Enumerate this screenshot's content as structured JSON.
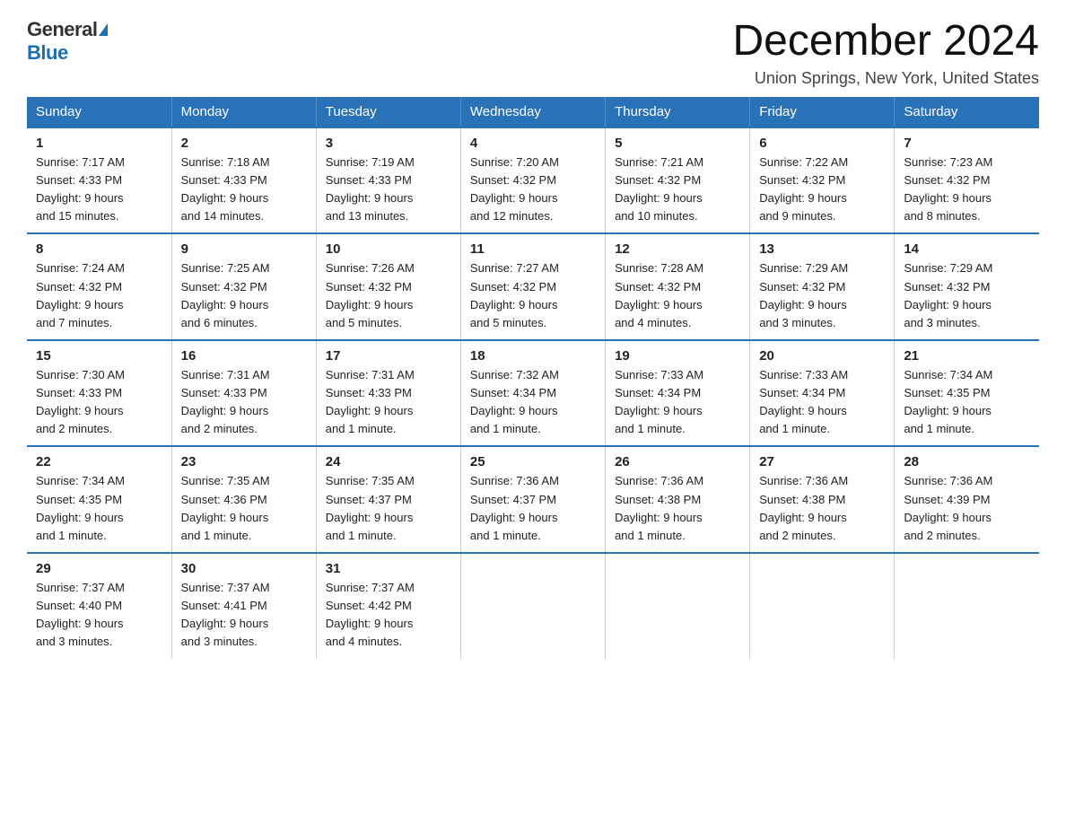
{
  "header": {
    "logo_general": "General",
    "logo_blue": "Blue",
    "month_title": "December 2024",
    "location": "Union Springs, New York, United States"
  },
  "weekdays": [
    "Sunday",
    "Monday",
    "Tuesday",
    "Wednesday",
    "Thursday",
    "Friday",
    "Saturday"
  ],
  "weeks": [
    [
      {
        "day": "1",
        "sunrise": "7:17 AM",
        "sunset": "4:33 PM",
        "daylight": "9 hours and 15 minutes."
      },
      {
        "day": "2",
        "sunrise": "7:18 AM",
        "sunset": "4:33 PM",
        "daylight": "9 hours and 14 minutes."
      },
      {
        "day": "3",
        "sunrise": "7:19 AM",
        "sunset": "4:33 PM",
        "daylight": "9 hours and 13 minutes."
      },
      {
        "day": "4",
        "sunrise": "7:20 AM",
        "sunset": "4:32 PM",
        "daylight": "9 hours and 12 minutes."
      },
      {
        "day": "5",
        "sunrise": "7:21 AM",
        "sunset": "4:32 PM",
        "daylight": "9 hours and 10 minutes."
      },
      {
        "day": "6",
        "sunrise": "7:22 AM",
        "sunset": "4:32 PM",
        "daylight": "9 hours and 9 minutes."
      },
      {
        "day": "7",
        "sunrise": "7:23 AM",
        "sunset": "4:32 PM",
        "daylight": "9 hours and 8 minutes."
      }
    ],
    [
      {
        "day": "8",
        "sunrise": "7:24 AM",
        "sunset": "4:32 PM",
        "daylight": "9 hours and 7 minutes."
      },
      {
        "day": "9",
        "sunrise": "7:25 AM",
        "sunset": "4:32 PM",
        "daylight": "9 hours and 6 minutes."
      },
      {
        "day": "10",
        "sunrise": "7:26 AM",
        "sunset": "4:32 PM",
        "daylight": "9 hours and 5 minutes."
      },
      {
        "day": "11",
        "sunrise": "7:27 AM",
        "sunset": "4:32 PM",
        "daylight": "9 hours and 5 minutes."
      },
      {
        "day": "12",
        "sunrise": "7:28 AM",
        "sunset": "4:32 PM",
        "daylight": "9 hours and 4 minutes."
      },
      {
        "day": "13",
        "sunrise": "7:29 AM",
        "sunset": "4:32 PM",
        "daylight": "9 hours and 3 minutes."
      },
      {
        "day": "14",
        "sunrise": "7:29 AM",
        "sunset": "4:32 PM",
        "daylight": "9 hours and 3 minutes."
      }
    ],
    [
      {
        "day": "15",
        "sunrise": "7:30 AM",
        "sunset": "4:33 PM",
        "daylight": "9 hours and 2 minutes."
      },
      {
        "day": "16",
        "sunrise": "7:31 AM",
        "sunset": "4:33 PM",
        "daylight": "9 hours and 2 minutes."
      },
      {
        "day": "17",
        "sunrise": "7:31 AM",
        "sunset": "4:33 PM",
        "daylight": "9 hours and 1 minute."
      },
      {
        "day": "18",
        "sunrise": "7:32 AM",
        "sunset": "4:34 PM",
        "daylight": "9 hours and 1 minute."
      },
      {
        "day": "19",
        "sunrise": "7:33 AM",
        "sunset": "4:34 PM",
        "daylight": "9 hours and 1 minute."
      },
      {
        "day": "20",
        "sunrise": "7:33 AM",
        "sunset": "4:34 PM",
        "daylight": "9 hours and 1 minute."
      },
      {
        "day": "21",
        "sunrise": "7:34 AM",
        "sunset": "4:35 PM",
        "daylight": "9 hours and 1 minute."
      }
    ],
    [
      {
        "day": "22",
        "sunrise": "7:34 AM",
        "sunset": "4:35 PM",
        "daylight": "9 hours and 1 minute."
      },
      {
        "day": "23",
        "sunrise": "7:35 AM",
        "sunset": "4:36 PM",
        "daylight": "9 hours and 1 minute."
      },
      {
        "day": "24",
        "sunrise": "7:35 AM",
        "sunset": "4:37 PM",
        "daylight": "9 hours and 1 minute."
      },
      {
        "day": "25",
        "sunrise": "7:36 AM",
        "sunset": "4:37 PM",
        "daylight": "9 hours and 1 minute."
      },
      {
        "day": "26",
        "sunrise": "7:36 AM",
        "sunset": "4:38 PM",
        "daylight": "9 hours and 1 minute."
      },
      {
        "day": "27",
        "sunrise": "7:36 AM",
        "sunset": "4:38 PM",
        "daylight": "9 hours and 2 minutes."
      },
      {
        "day": "28",
        "sunrise": "7:36 AM",
        "sunset": "4:39 PM",
        "daylight": "9 hours and 2 minutes."
      }
    ],
    [
      {
        "day": "29",
        "sunrise": "7:37 AM",
        "sunset": "4:40 PM",
        "daylight": "9 hours and 3 minutes."
      },
      {
        "day": "30",
        "sunrise": "7:37 AM",
        "sunset": "4:41 PM",
        "daylight": "9 hours and 3 minutes."
      },
      {
        "day": "31",
        "sunrise": "7:37 AM",
        "sunset": "4:42 PM",
        "daylight": "9 hours and 4 minutes."
      },
      null,
      null,
      null,
      null
    ]
  ],
  "labels": {
    "sunrise": "Sunrise:",
    "sunset": "Sunset:",
    "daylight": "Daylight:"
  }
}
